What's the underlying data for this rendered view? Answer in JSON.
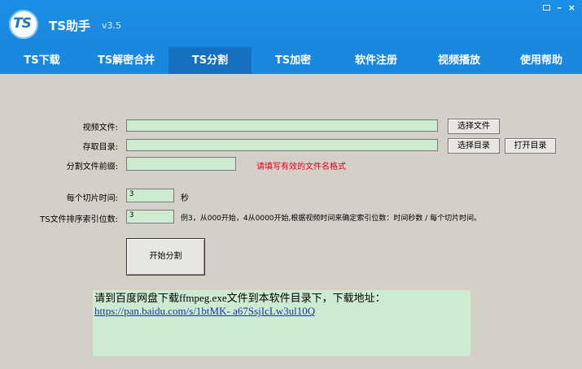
{
  "window": {
    "logo_text": "TS",
    "app_name": "TS助手",
    "version": "v3.5"
  },
  "tabs": [
    {
      "label": "TS下载",
      "active": false
    },
    {
      "label": "TS解密合并",
      "active": false
    },
    {
      "label": "TS分割",
      "active": true
    },
    {
      "label": "TS加密",
      "active": false
    },
    {
      "label": "软件注册",
      "active": false
    },
    {
      "label": "视频播放",
      "active": false
    },
    {
      "label": "使用帮助",
      "active": false
    }
  ],
  "form": {
    "video_file_label": "视频文件:",
    "video_file_value": "",
    "save_dir_label": "存取目录:",
    "save_dir_value": "",
    "prefix_label": "分割文件前缀:",
    "prefix_value": "",
    "prefix_hint": "请填写有效的文件名格式",
    "choose_file_btn": "选择文件",
    "choose_dir_btn": "选择目录",
    "open_dir_btn": "打开目录",
    "slice_time_label": "每个切片时间:",
    "slice_time_value": "3",
    "slice_time_unit": "秒",
    "index_digits_label": "TS文件排序索引位数:",
    "index_digits_value": "3",
    "index_digits_hint": "例3，从000开始，4从0000开始,根据视频时间来确定索引位数：时间秒数 / 每个切片时间。",
    "start_btn": "开始分割"
  },
  "info": {
    "line1": "请到百度网盘下载ffmpeg.exe文件到本软件目录下，下载地址：",
    "link": "https://pan.baidu.com/s/1btMK- a67SsjIcLw3ul10Q"
  },
  "colors": {
    "accent": "#1a88de",
    "active_tab": "#1571c0",
    "field_bg": "#cdebd1",
    "window_bg": "#d4d0c8",
    "hint_red": "#e0001a",
    "link": "#1a33b4"
  }
}
